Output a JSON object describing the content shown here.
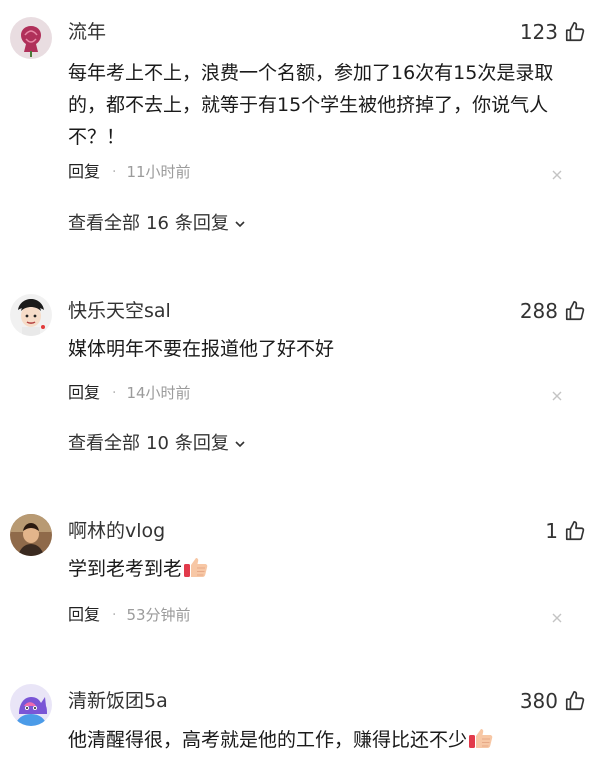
{
  "comments": [
    {
      "username": "流年",
      "likes": "123",
      "text": "每年考上不上，浪费一个名额，参加了16次有15次是录取的，都不去上，就等于有15个学生被他挤掉了，你说气人不？！",
      "reply_label": "回复",
      "time": "11小时前",
      "view_replies_prefix": "查看全部",
      "view_replies_count": "16",
      "view_replies_suffix": "条回复"
    },
    {
      "username": "快乐天空sal",
      "likes": "288",
      "text": "媒体明年不要在报道他了好不好",
      "reply_label": "回复",
      "time": "14小时前",
      "view_replies_prefix": "查看全部",
      "view_replies_count": "10",
      "view_replies_suffix": "条回复"
    },
    {
      "username": "啊林的vlog",
      "likes": "1",
      "text": "学到老考到老",
      "reply_label": "回复",
      "time": "53分钟前"
    },
    {
      "username": "清新饭团5a",
      "likes": "380",
      "text": "他清醒得很，高考就是他的工作，赚得比还不少"
    }
  ],
  "icons": {
    "like": "thumbs-up-outline-icon",
    "close": "close-icon",
    "expand": "chevron-down-icon",
    "emoji": "thumbs-up-emoji-icon"
  },
  "colors": {
    "text_primary": "#1a1a1a",
    "text_secondary": "#9b9b9b"
  }
}
